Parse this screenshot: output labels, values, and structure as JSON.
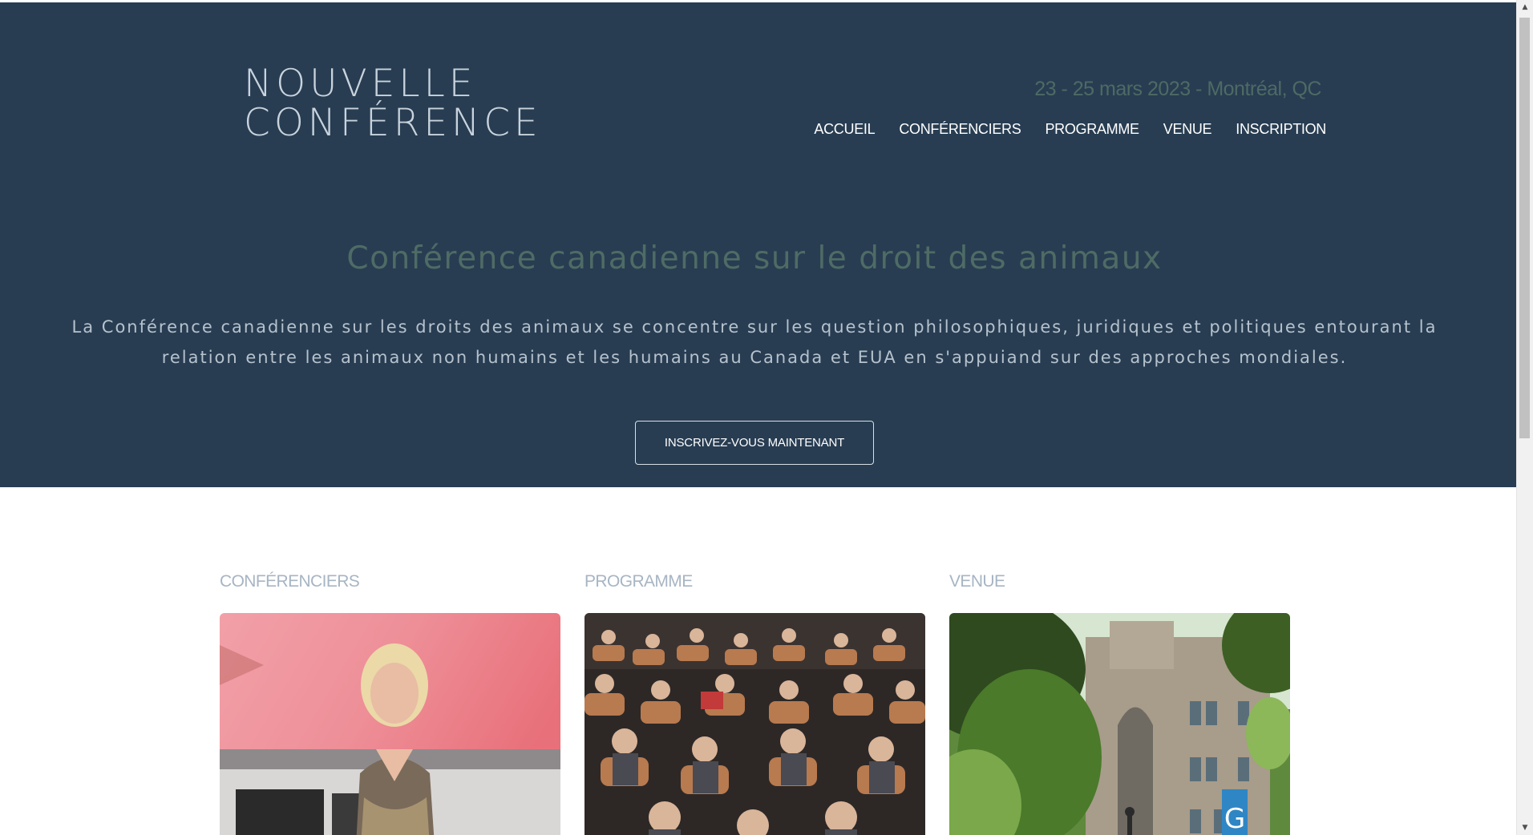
{
  "header": {
    "logo_line1": "NOUVELLE",
    "logo_line2": "CONFÉRENCE",
    "event_date": "23 - 25 mars 2023 - Montréal, QC",
    "nav": [
      {
        "label": "ACCUEIL"
      },
      {
        "label": "CONFÉRENCIERS"
      },
      {
        "label": "PROGRAMME"
      },
      {
        "label": "VENUE"
      },
      {
        "label": "INSCRIPTION"
      }
    ]
  },
  "hero": {
    "title": "Conférence canadienne sur le droit des animaux",
    "description": "La Conférence canadienne sur les droits des animaux se concentre sur les question philosophiques, juridiques et politiques entourant la relation entre les animaux non humains et les humains au Canada et EUA en s'appuiand sur des approches mondiales.",
    "cta_label": "INSCRIVEZ-VOUS MAINTENANT"
  },
  "sections": [
    {
      "label": "CONFÉRENCIERS",
      "image": "speaker-portrait"
    },
    {
      "label": "PROGRAMME",
      "image": "audience-photo"
    },
    {
      "label": "VENUE",
      "image": "venue-building-photo"
    }
  ],
  "colors": {
    "hero_bg": "#283d52",
    "accent": "#4e6b65",
    "section_label": "#a7b5c3"
  },
  "scrollbar": {
    "up_icon": "arrow-up-icon",
    "down_icon": "arrow-down-icon"
  }
}
